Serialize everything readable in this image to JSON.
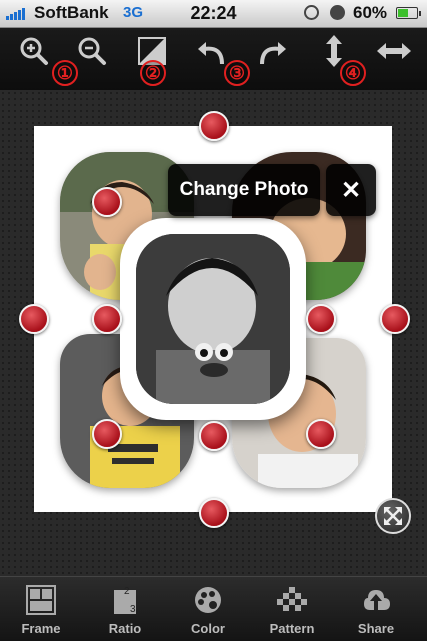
{
  "status_bar": {
    "carrier": "SoftBank",
    "network": "3G",
    "time": "22:24",
    "battery_percent": "60%",
    "battery_level": 0.6
  },
  "toolbar": {
    "tools": [
      "zoom-in-icon",
      "zoom-out-icon",
      "contrast-icon",
      "undo-icon",
      "redo-icon",
      "vertical-arrows-icon",
      "horizontal-arrows-icon"
    ],
    "badges": [
      "①",
      "②",
      "③",
      "④"
    ]
  },
  "popup": {
    "change_photo_label": "Change Photo",
    "close_label": "✕"
  },
  "tabbar": {
    "tabs": [
      {
        "label": "Frame",
        "icon": "frame-icon"
      },
      {
        "label": "Ratio",
        "icon": "ratio-icon"
      },
      {
        "label": "Color",
        "icon": "color-icon"
      },
      {
        "label": "Pattern",
        "icon": "pattern-icon"
      },
      {
        "label": "Share",
        "icon": "share-icon"
      }
    ]
  },
  "colors": {
    "handle": "#c0212a",
    "badge": "#e02020",
    "carrier_blue": "#1a6fd1",
    "battery_green": "#3cbf2c"
  }
}
